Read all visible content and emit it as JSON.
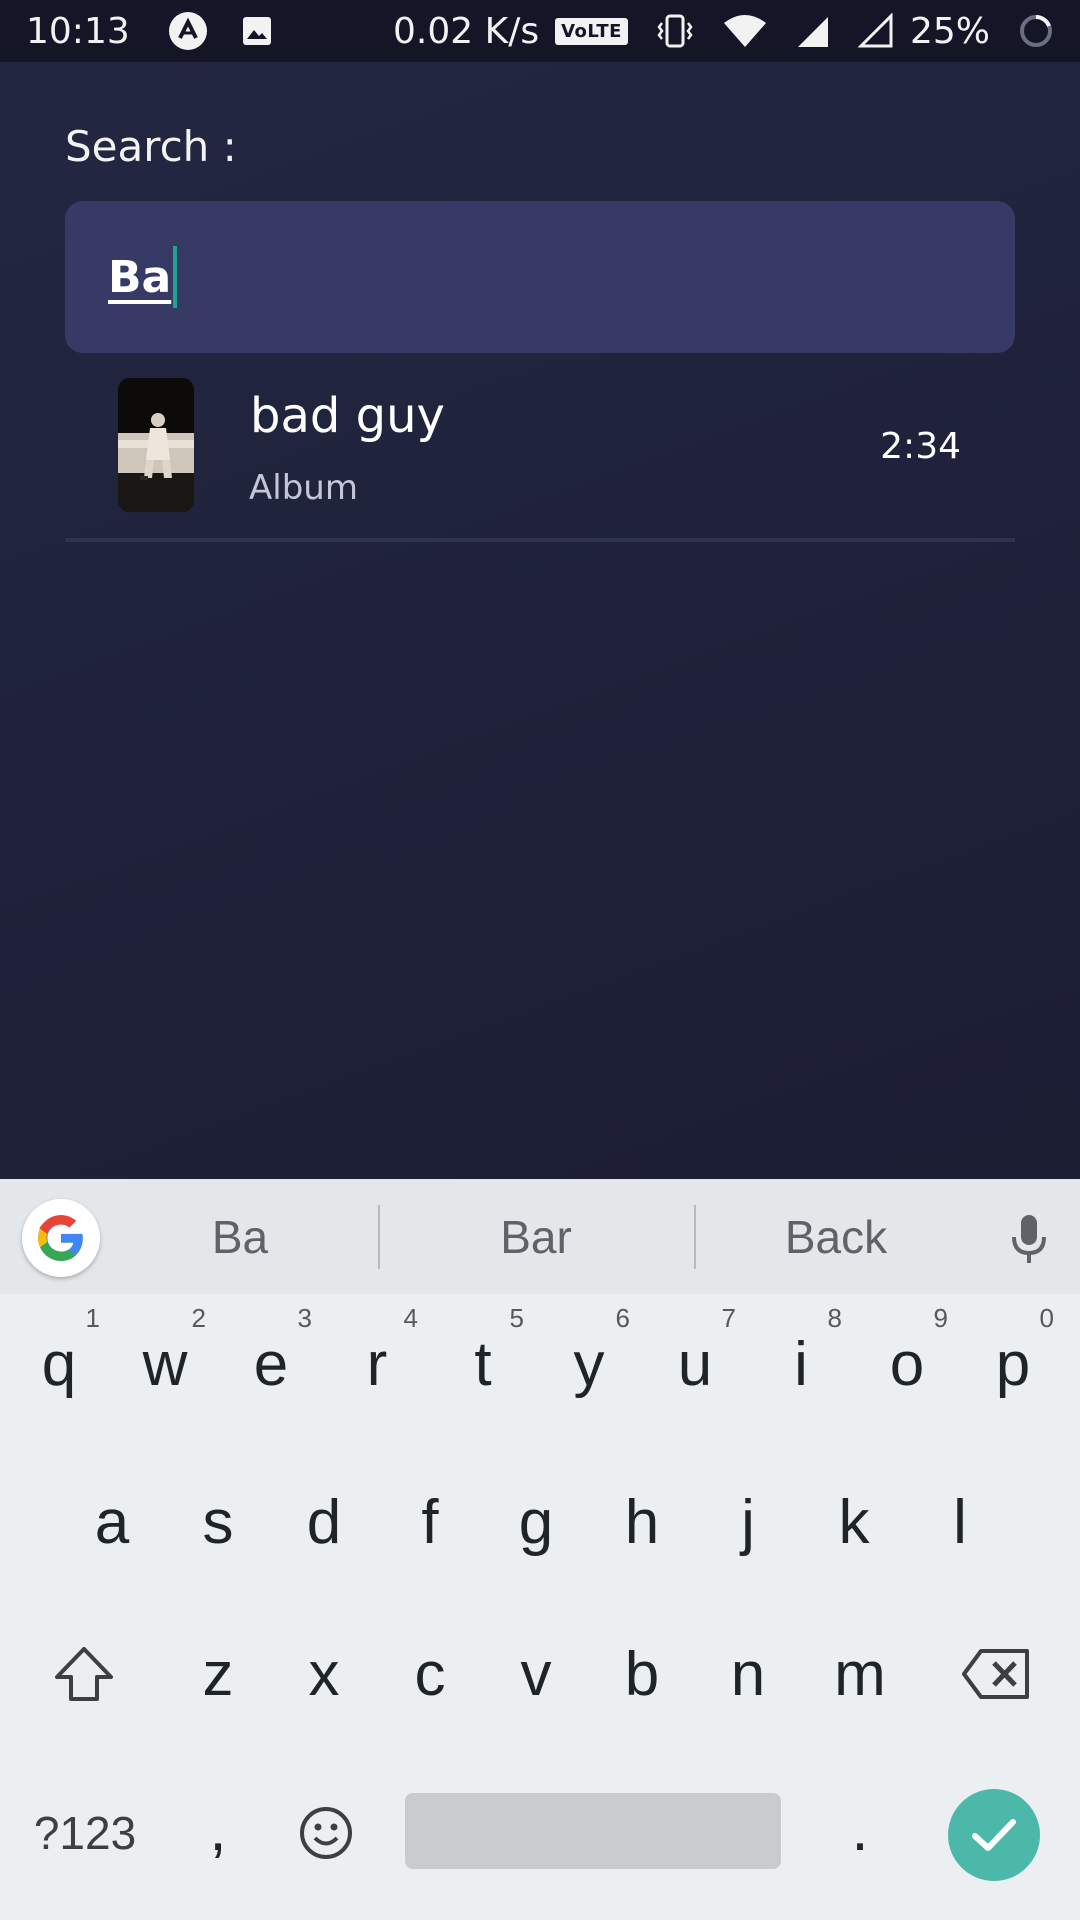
{
  "status_bar": {
    "time": "10:13",
    "network_speed": "0.02 K/s",
    "volte": "VoLTE",
    "battery": "25%",
    "icons": [
      "app-notification-icon",
      "image-notification-icon",
      "vibrate-icon",
      "wifi-icon",
      "signal-icon",
      "signal-empty-icon",
      "battery-ring-icon"
    ]
  },
  "search": {
    "label": "Search :",
    "value": "Ba"
  },
  "results": [
    {
      "title": "bad guy",
      "subtitle": "Album",
      "duration": "2:34",
      "thumbnail": "album-cover"
    }
  ],
  "keyboard": {
    "suggestions": [
      "Ba",
      "Bar",
      "Back"
    ],
    "row1": [
      {
        "key": "q",
        "hint": "1"
      },
      {
        "key": "w",
        "hint": "2"
      },
      {
        "key": "e",
        "hint": "3"
      },
      {
        "key": "r",
        "hint": "4"
      },
      {
        "key": "t",
        "hint": "5"
      },
      {
        "key": "y",
        "hint": "6"
      },
      {
        "key": "u",
        "hint": "7"
      },
      {
        "key": "i",
        "hint": "8"
      },
      {
        "key": "o",
        "hint": "9"
      },
      {
        "key": "p",
        "hint": "0"
      }
    ],
    "row2": [
      "a",
      "s",
      "d",
      "f",
      "g",
      "h",
      "j",
      "k",
      "l"
    ],
    "row3": [
      "z",
      "x",
      "c",
      "v",
      "b",
      "n",
      "m"
    ],
    "symbols_label": "?123",
    "comma": ",",
    "period": ".",
    "accent_color": "#4bb8a9"
  }
}
